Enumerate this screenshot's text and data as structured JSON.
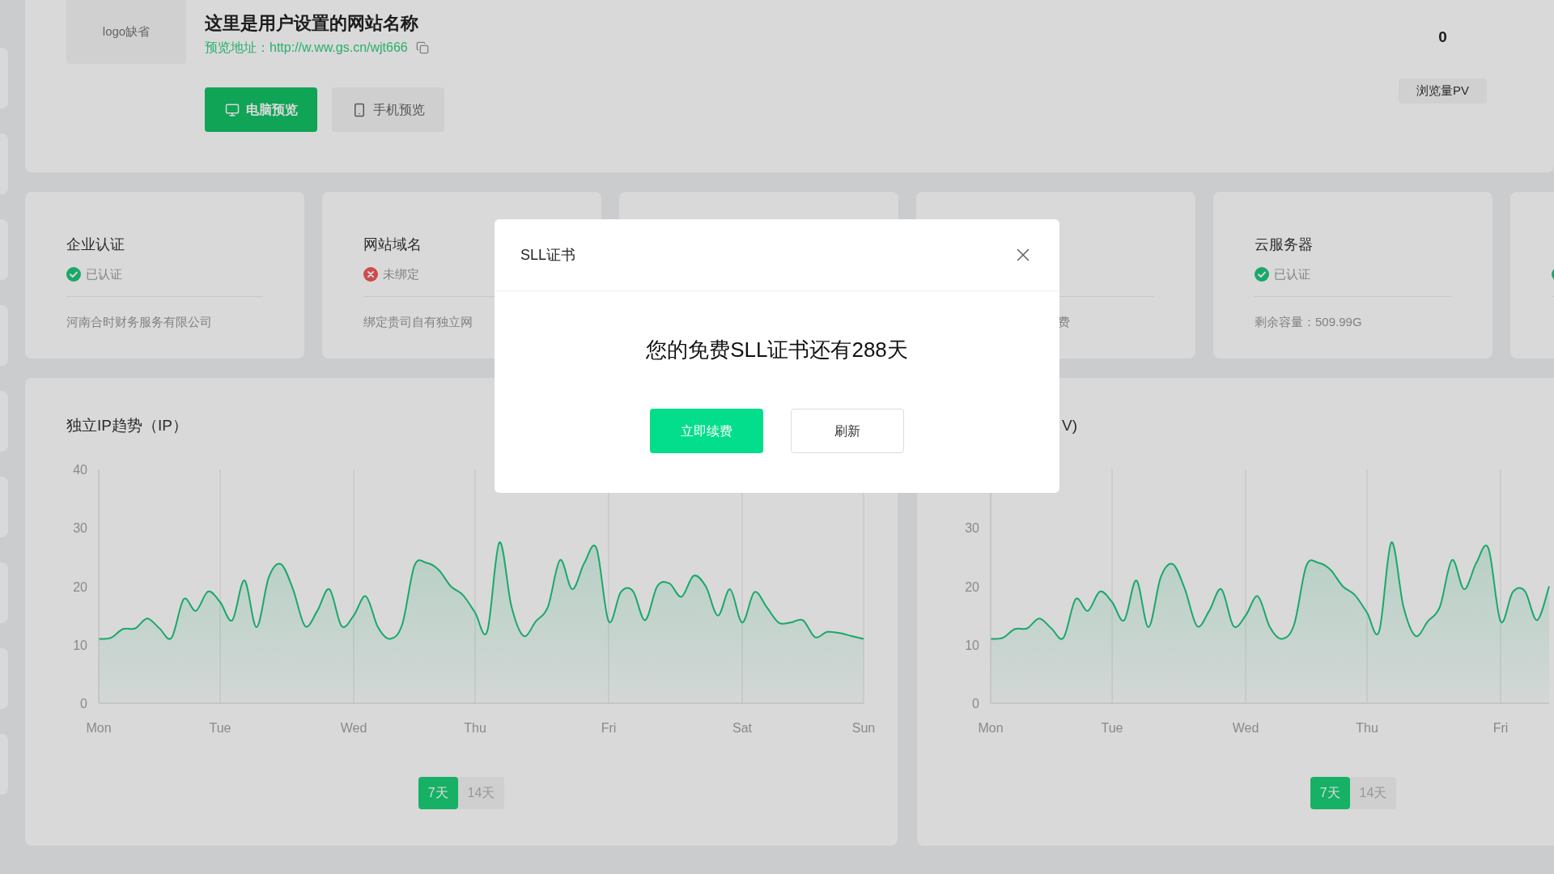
{
  "header": {
    "logo_placeholder": "logo缺省",
    "site_name": "这里是用户设置的网站名称",
    "preview_label": "预览地址：",
    "preview_url": "http://w.ww.gs.cn/wjt666",
    "buttons": [
      {
        "label": "电脑预览",
        "kind": "desktop",
        "selected": true
      },
      {
        "label": "手机预览",
        "kind": "mobile",
        "selected": false
      }
    ],
    "stat": {
      "value": "0",
      "label": "浏览量PV"
    }
  },
  "cards": [
    {
      "kind": "info",
      "title": "企业认证",
      "status": {
        "label": "已认证",
        "ok": true
      },
      "detail": "河南合时财务服务有限公司"
    },
    {
      "kind": "info",
      "title": "网站域名",
      "status": {
        "label": "未绑定",
        "ok": false
      },
      "detail": "绑定贵司自有独立网"
    },
    {
      "kind": "blank"
    },
    {
      "kind": "info",
      "detail": "费"
    },
    {
      "kind": "info",
      "title": "云服务器",
      "status": {
        "label": "已认证",
        "ok": true
      },
      "detail": "剩余容量：509.99G"
    },
    {
      "kind": "info",
      "status": {
        "ok": true
      }
    }
  ],
  "charts": [
    {
      "title": "独立IP趋势（IP）",
      "chart_data": {
        "type": "area",
        "grid": "x",
        "ylim": [
          0,
          40
        ],
        "yticks": [
          0,
          10,
          20,
          30,
          40
        ],
        "categories": [
          "Mon",
          null,
          null,
          null,
          null,
          null,
          null,
          null,
          null,
          null,
          "Tue",
          null,
          null,
          null,
          null,
          null,
          null,
          null,
          null,
          null,
          null,
          "Wed",
          null,
          null,
          null,
          null,
          null,
          null,
          null,
          null,
          null,
          "Thu",
          null,
          null,
          null,
          null,
          null,
          null,
          null,
          null,
          null,
          null,
          "Fri",
          null,
          null,
          null,
          null,
          null,
          null,
          null,
          null,
          null,
          null,
          "Sat",
          null,
          null,
          null,
          null,
          null,
          null,
          null,
          null,
          null,
          "Sun"
        ],
        "series": [
          {
            "color": "#1fc67d",
            "values": [
              11,
              11.2,
              12.7,
              12.8,
              14.5,
              12.8,
              11.2,
              17.8,
              15.8,
              19.1,
              17.3,
              14.2,
              21,
              13,
              21.5,
              23.8,
              19.5,
              13.2,
              15.8,
              19.5,
              13.2,
              15,
              18.3,
              13,
              11,
              13.5,
              23.5,
              24,
              22.8,
              20,
              18.5,
              15.5,
              12.3,
              27.5,
              16.5,
              11.5,
              14,
              16.5,
              24.5,
              19.5,
              24,
              26.5,
              14,
              19,
              19.2,
              14.2,
              20,
              20.5,
              18.2,
              21.8,
              20,
              15,
              19.5,
              13.8,
              19,
              16.5,
              13.8,
              13.8,
              14.2,
              11.3,
              12.2,
              12,
              11.5,
              11
            ]
          }
        ]
      },
      "ranges": [
        {
          "label": "7天",
          "selected": true
        },
        {
          "label": "14天",
          "selected": false
        }
      ]
    },
    {
      "title": "V)",
      "chart_data": {
        "type": "area",
        "grid": "x",
        "ylim": [
          0,
          40
        ],
        "yticks": [
          0,
          10,
          20,
          30
        ],
        "categories": [
          "Mon",
          null,
          null,
          null,
          null,
          null,
          null,
          null,
          null,
          null,
          "Tue",
          null,
          null,
          null,
          null,
          null,
          null,
          null,
          null,
          null,
          null,
          "Wed",
          null,
          null,
          null,
          null,
          null,
          null,
          null,
          null,
          null,
          "Thu",
          null,
          null,
          null,
          null,
          null,
          null,
          null,
          null,
          null,
          null,
          "Fri",
          null,
          null,
          null,
          null
        ],
        "series": [
          {
            "color": "#1fc67d",
            "values": [
              11,
              11.2,
              12.7,
              12.8,
              14.5,
              12.8,
              11.2,
              17.8,
              15.8,
              19.1,
              17.3,
              14.2,
              21,
              13,
              21.5,
              23.8,
              19.5,
              13.2,
              15.8,
              19.5,
              13.2,
              15,
              18.3,
              13,
              11,
              13.5,
              23.5,
              24,
              22.8,
              20,
              18.5,
              15.5,
              12.3,
              27.5,
              16.5,
              11.5,
              14,
              16.5,
              24.5,
              19.5,
              24,
              26.5,
              14,
              19,
              19.2,
              14.2,
              20
            ]
          }
        ]
      },
      "ranges": [
        {
          "label": "7天",
          "selected": true
        },
        {
          "label": "14天",
          "selected": false
        }
      ]
    }
  ],
  "modal": {
    "title": "SLL证书",
    "message": "您的免费SLL证书还有288天",
    "buttons": [
      {
        "label": "立即续费",
        "kind": "primary"
      },
      {
        "label": "刷新",
        "kind": "default"
      }
    ]
  }
}
